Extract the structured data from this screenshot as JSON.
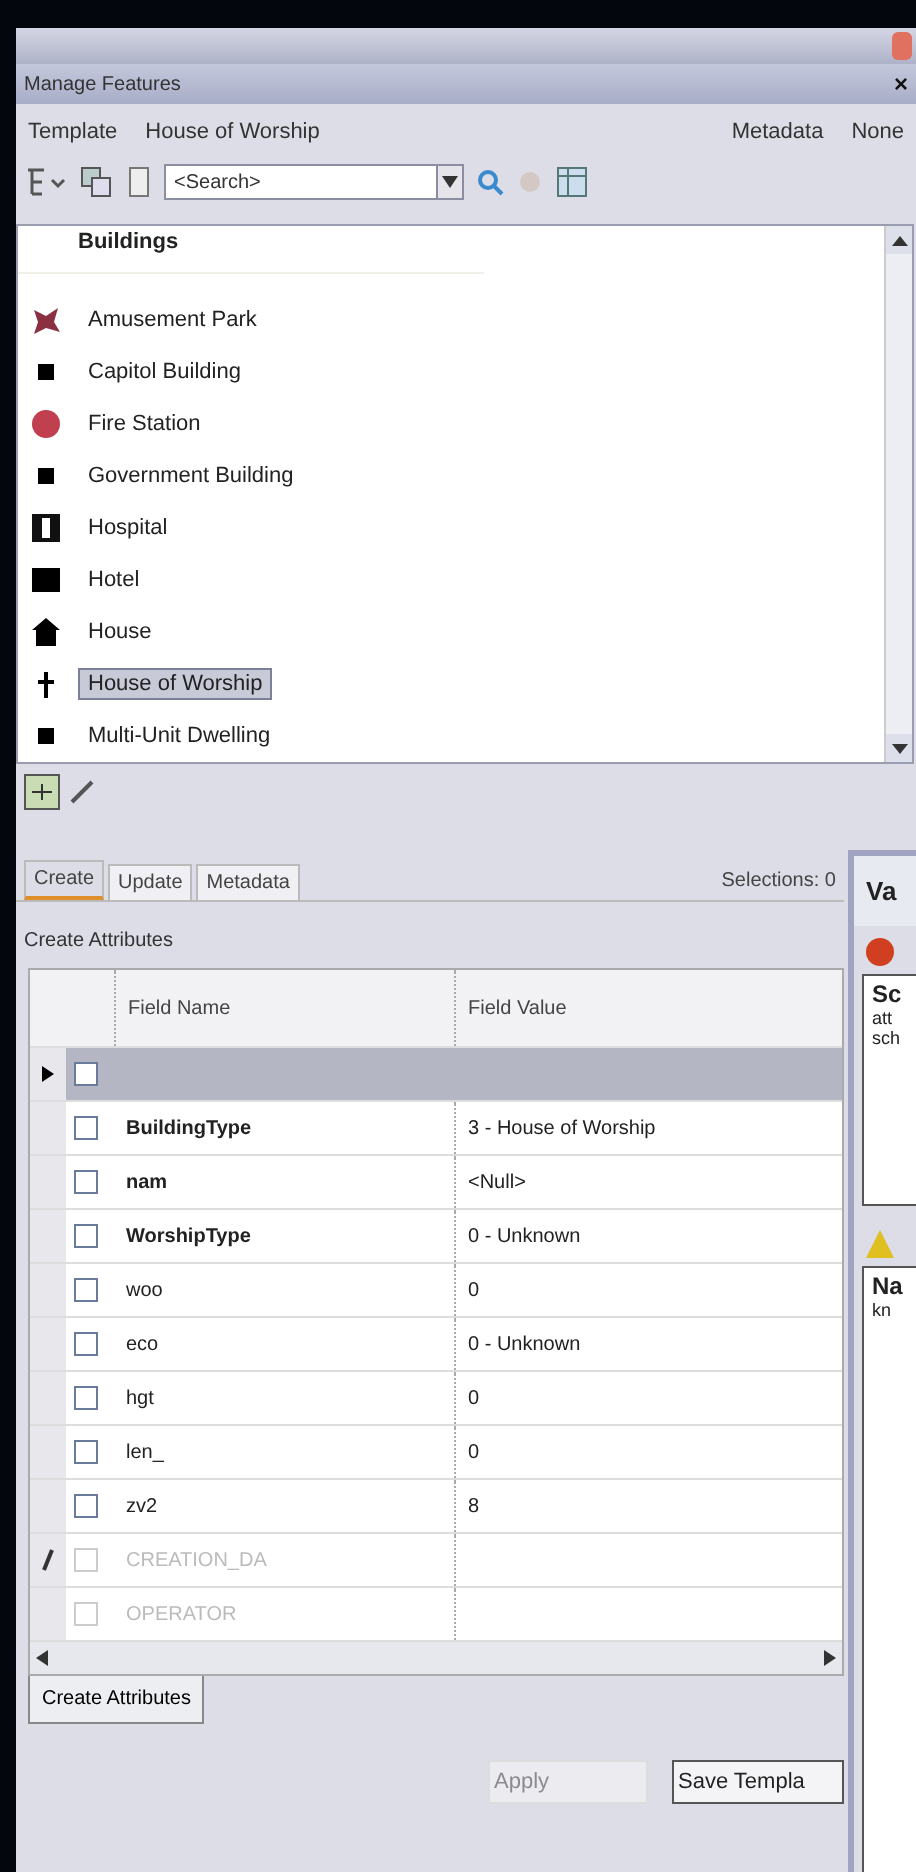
{
  "window": {
    "title": "Manage Features",
    "close": "×"
  },
  "template": {
    "label": "Template",
    "value": "House of Worship",
    "metadata_label": "Metadata",
    "metadata_value": "None"
  },
  "search": {
    "placeholder": "<Search>"
  },
  "feature_list": {
    "group": "Buildings",
    "items": [
      {
        "label": "Amusement Park",
        "kind": "amusement",
        "selected": false
      },
      {
        "label": "Capitol Building",
        "kind": "square",
        "selected": false
      },
      {
        "label": "Fire Station",
        "kind": "fire",
        "selected": false
      },
      {
        "label": "Government Building",
        "kind": "square",
        "selected": false
      },
      {
        "label": "Hospital",
        "kind": "hospital",
        "selected": false
      },
      {
        "label": "Hotel",
        "kind": "hotel",
        "selected": false
      },
      {
        "label": "House",
        "kind": "house",
        "selected": false
      },
      {
        "label": "House of Worship",
        "kind": "worship",
        "selected": true
      },
      {
        "label": "Multi-Unit Dwelling",
        "kind": "square",
        "selected": false
      }
    ]
  },
  "tabs": [
    {
      "label": "Create",
      "selected": true
    },
    {
      "label": "Update",
      "selected": false
    },
    {
      "label": "Metadata",
      "selected": false
    }
  ],
  "selections": "Selections: 0",
  "section_title": "Create Attributes",
  "table": {
    "columns": [
      "Field Name",
      "Field Value"
    ],
    "rows": [
      {
        "kind": "group",
        "current": true,
        "editing": false,
        "checked": false
      },
      {
        "kind": "field",
        "name": "BuildingType",
        "value": "3 - House of Worship",
        "bold": true,
        "disabled": false,
        "checked": false,
        "current": false,
        "editing": false
      },
      {
        "kind": "field",
        "name": "nam",
        "value": "<Null>",
        "bold": true,
        "disabled": false,
        "checked": false,
        "current": false,
        "editing": false
      },
      {
        "kind": "field",
        "name": "WorshipType",
        "value": "0 - Unknown",
        "bold": true,
        "disabled": false,
        "checked": false,
        "current": false,
        "editing": false
      },
      {
        "kind": "field",
        "name": "woo",
        "value": "0",
        "bold": false,
        "disabled": false,
        "checked": false,
        "current": false,
        "editing": false
      },
      {
        "kind": "field",
        "name": "eco",
        "value": "0 - Unknown",
        "bold": false,
        "disabled": false,
        "checked": false,
        "current": false,
        "editing": false
      },
      {
        "kind": "field",
        "name": "hgt",
        "value": "0",
        "bold": false,
        "disabled": false,
        "checked": false,
        "current": false,
        "editing": false
      },
      {
        "kind": "field",
        "name": "len_",
        "value": "0",
        "bold": false,
        "disabled": false,
        "checked": false,
        "current": false,
        "editing": false
      },
      {
        "kind": "field",
        "name": "zv2",
        "value": "8",
        "bold": false,
        "disabled": false,
        "checked": false,
        "current": false,
        "editing": false
      },
      {
        "kind": "field",
        "name": "CREATION_DA",
        "bold": false,
        "disabled": true,
        "checked": false,
        "current": false,
        "editing": true
      },
      {
        "kind": "field",
        "name": "OPERATOR",
        "bold": false,
        "disabled": true,
        "checked": false,
        "current": false,
        "editing": false
      }
    ]
  },
  "create_button": "Create Attributes",
  "buttons": [
    {
      "label": "Apply",
      "disabled": true
    },
    {
      "label": "Save Templa",
      "disabled": false
    }
  ],
  "dialog": {
    "title": "Va",
    "error_lines": [
      "Sc",
      "att",
      "sch"
    ],
    "warning_lines": [
      "Na",
      "kn"
    ]
  }
}
